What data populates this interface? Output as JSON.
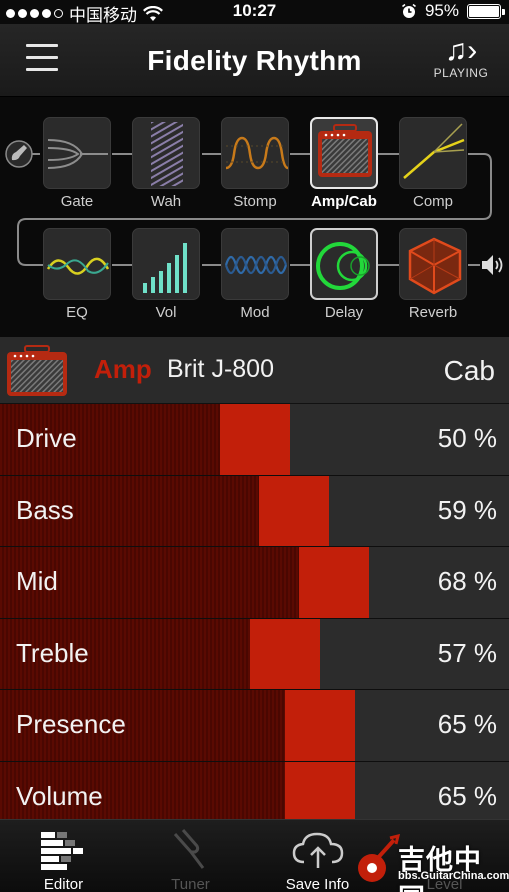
{
  "status_bar": {
    "carrier": "中国移动",
    "time": "10:27",
    "battery": "95%"
  },
  "header": {
    "title": "Fidelity Rhythm",
    "playing_label": "PLAYING"
  },
  "chain": {
    "row1": [
      "Gate",
      "Wah",
      "Stomp",
      "Amp/Cab",
      "Comp"
    ],
    "row2": [
      "EQ",
      "Vol",
      "Mod",
      "Delay",
      "Reverb"
    ],
    "selected": "Amp/Cab"
  },
  "amp_header": {
    "section": "Amp",
    "model": "Brit J-800",
    "cab_button": "Cab"
  },
  "parameters": [
    {
      "name": "Drive",
      "value": 50,
      "label": "50 %"
    },
    {
      "name": "Bass",
      "value": 59,
      "label": "59 %"
    },
    {
      "name": "Mid",
      "value": 68,
      "label": "68 %"
    },
    {
      "name": "Treble",
      "value": 57,
      "label": "57 %"
    },
    {
      "name": "Presence",
      "value": 65,
      "label": "65 %"
    },
    {
      "name": "Volume",
      "value": 65,
      "label": "65 %"
    }
  ],
  "tabbar": {
    "tabs": [
      "Editor",
      "Tuner",
      "Save Info",
      "Level"
    ],
    "active": "Editor"
  },
  "watermark": {
    "text": "吉他中国",
    "url": "bbs.GuitarChina.com"
  },
  "colors": {
    "accent_red": "#c21f0a",
    "dark_red": "#5a0a02",
    "selection_white": "#e8e8e8"
  }
}
